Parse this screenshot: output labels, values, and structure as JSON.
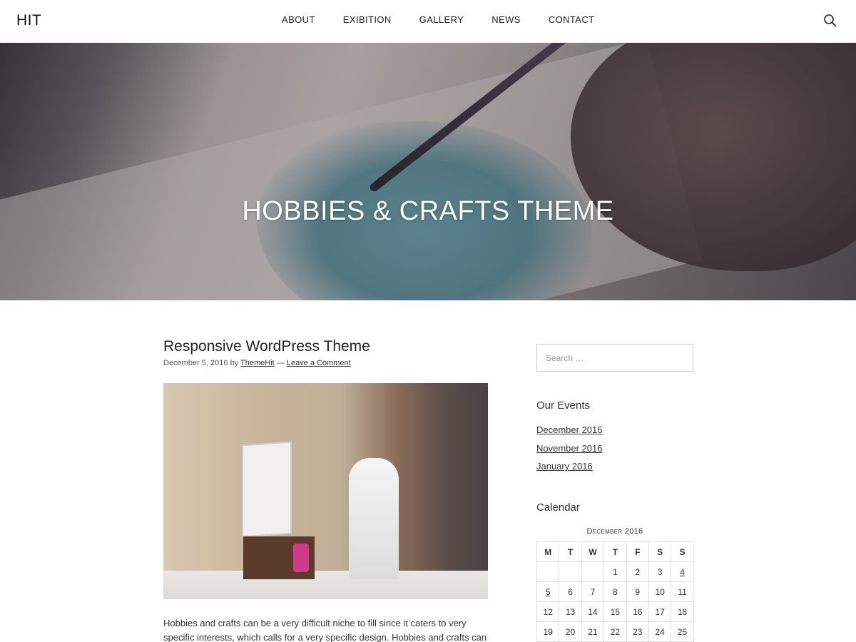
{
  "header": {
    "logo": "HIT",
    "nav": [
      "ABOUT",
      "EXIBITION",
      "GALLERY",
      "NEWS",
      "CONTACT"
    ]
  },
  "hero": {
    "title": "HOBBIES & CRAFTS THEME"
  },
  "post": {
    "title": "Responsive WordPress Theme",
    "date": "December 5, 2016",
    "by": "by",
    "author": "ThemeHit",
    "separator": "—",
    "comment_link": "Leave a Comment",
    "excerpt": "Hobbies and crafts can be a very difficult niche to fill since it caters to very specific interests, which calls for a very specific design. Hobbies and crafts can"
  },
  "sidebar": {
    "search_placeholder": "Search …",
    "events_title": "Our Events",
    "events": [
      "December 2016",
      "November 2016",
      "January 2016"
    ],
    "calendar_title": "Calendar",
    "calendar_caption": "December 2016",
    "calendar_days": [
      "M",
      "T",
      "W",
      "T",
      "F",
      "S",
      "S"
    ],
    "calendar_rows": [
      [
        "",
        "",
        "",
        "1",
        "2",
        "3",
        "4"
      ],
      [
        "5",
        "6",
        "7",
        "8",
        "9",
        "10",
        "11"
      ],
      [
        "12",
        "13",
        "14",
        "15",
        "16",
        "17",
        "18"
      ],
      [
        "19",
        "20",
        "21",
        "22",
        "23",
        "24",
        "25"
      ]
    ],
    "calendar_linked_days": [
      "4",
      "5"
    ]
  }
}
